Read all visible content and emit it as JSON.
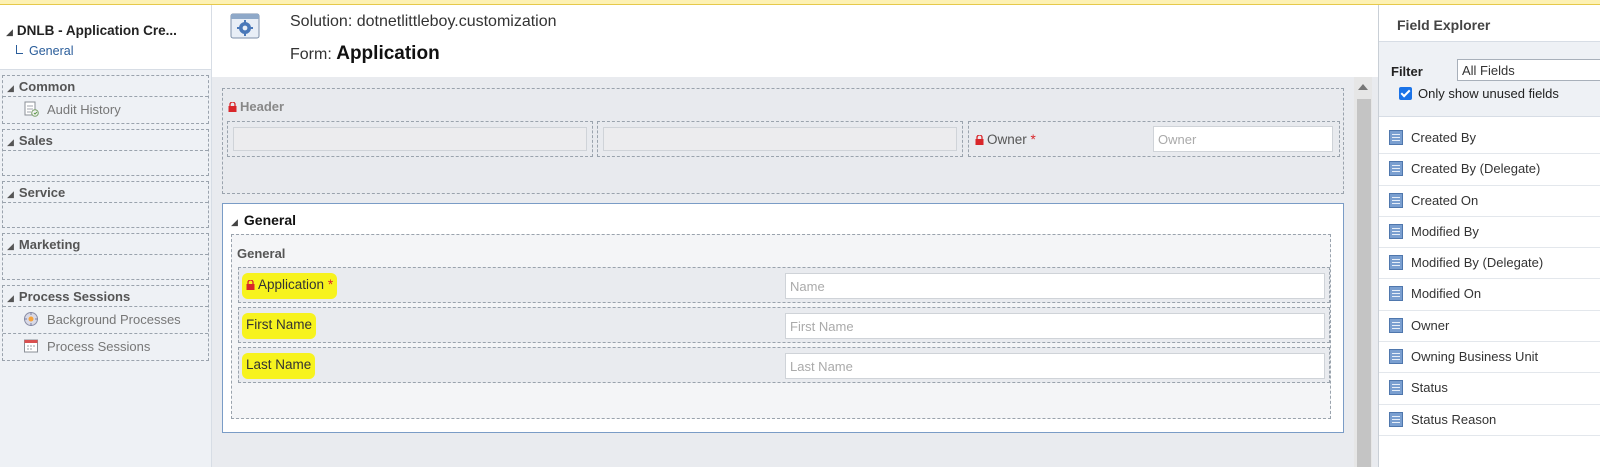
{
  "left_nav": {
    "entity_title": "DNLB - Application Cre...",
    "general_link": "General",
    "sections": [
      {
        "title": "Common",
        "items": [
          "Audit History"
        ]
      },
      {
        "title": "Sales",
        "items": []
      },
      {
        "title": "Service",
        "items": []
      },
      {
        "title": "Marketing",
        "items": []
      },
      {
        "title": "Process Sessions",
        "items": [
          "Background Processes",
          "Process Sessions"
        ]
      }
    ]
  },
  "form_header": {
    "solution_label": "Solution: dotnetlittleboy.customization",
    "form_prefix": "Form:",
    "form_name": "Application"
  },
  "header_section": {
    "title": "Header",
    "owner_label": "Owner",
    "owner_required": "*",
    "owner_placeholder": "Owner"
  },
  "general_tab": {
    "title": "General",
    "section_title": "General",
    "rows": [
      {
        "label": "Application",
        "required": "*",
        "placeholder": "Name"
      },
      {
        "label": "First Name",
        "required": "",
        "placeholder": "First Name"
      },
      {
        "label": "Last Name",
        "required": "",
        "placeholder": "Last Name"
      }
    ]
  },
  "field_explorer": {
    "title": "Field Explorer",
    "filter_label": "Filter",
    "filter_value": "All Fields",
    "only_unused_label": "Only show unused fields",
    "only_unused_checked": true,
    "fields": [
      "Created By",
      "Created By (Delegate)",
      "Created On",
      "Modified By",
      "Modified By (Delegate)",
      "Modified On",
      "Owner",
      "Owning Business Unit",
      "Status",
      "Status Reason"
    ]
  },
  "colors": {
    "highlight": "#f7f31e",
    "required": "#d9262a",
    "tab_border": "#7a9cc6"
  }
}
